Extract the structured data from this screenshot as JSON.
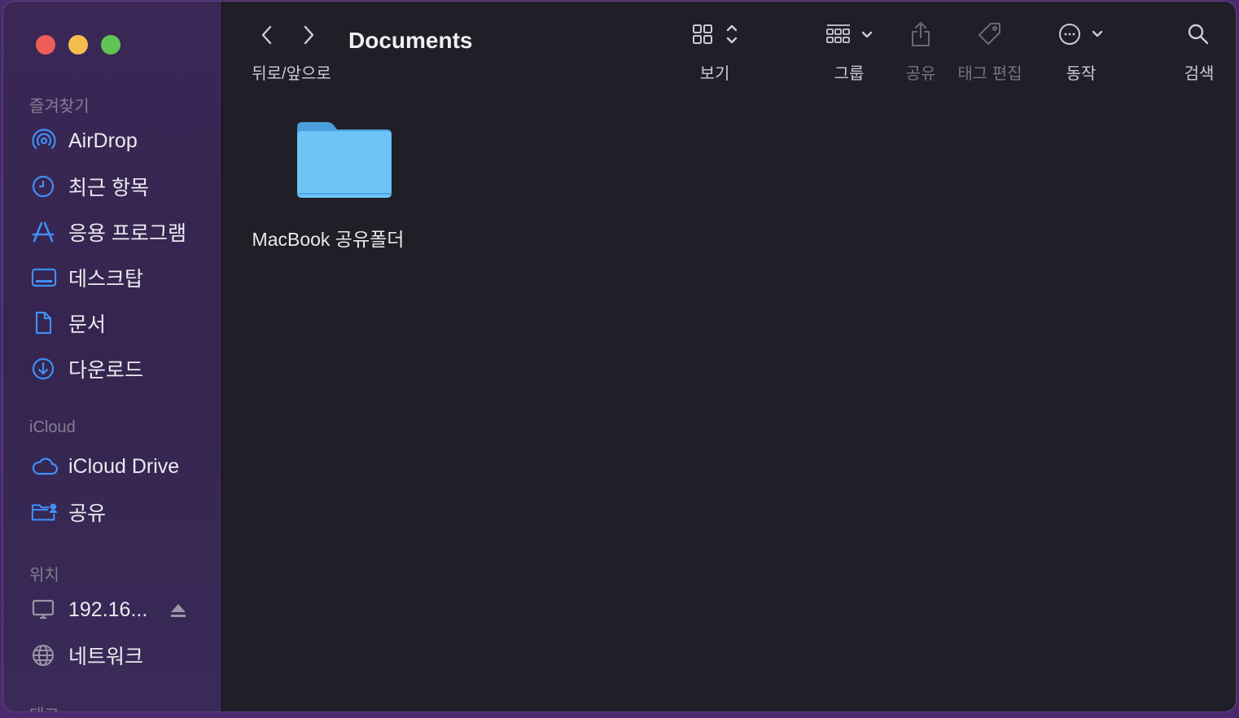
{
  "window": {
    "title": "Documents"
  },
  "colors": {
    "sidebar_bg": "#372652",
    "content_bg": "#201e26",
    "accent_icon": "#3f8ff6",
    "folder_blue": "#6cc4f7"
  },
  "sidebar": {
    "sections": [
      {
        "title": "즐겨찾기",
        "items": [
          {
            "label": "AirDrop",
            "icon": "airdrop-icon"
          },
          {
            "label": "최근 항목",
            "icon": "clock-icon"
          },
          {
            "label": "응용 프로그램",
            "icon": "applications-icon"
          },
          {
            "label": "데스크탑",
            "icon": "desktop-icon"
          },
          {
            "label": "문서",
            "icon": "document-icon"
          },
          {
            "label": "다운로드",
            "icon": "download-icon"
          }
        ]
      },
      {
        "title": "iCloud",
        "items": [
          {
            "label": "iCloud Drive",
            "icon": "cloud-icon"
          },
          {
            "label": "공유",
            "icon": "shared-folder-icon"
          }
        ]
      },
      {
        "title": "위치",
        "items": [
          {
            "label": "192.16...",
            "icon": "computer-icon"
          },
          {
            "label": "네트워크",
            "icon": "globe-icon"
          }
        ]
      }
    ],
    "next_section_partial": "태그"
  },
  "toolbar": {
    "back_forward_label": "뒤로/앞으로",
    "view_label": "보기",
    "group_label": "그룹",
    "share_label": "공유",
    "tag_label": "태그 편집",
    "action_label": "동작",
    "search_label": "검색"
  },
  "content": {
    "items": [
      {
        "name": "MacBook 공유폴더",
        "icon": "folder-icon"
      }
    ]
  }
}
